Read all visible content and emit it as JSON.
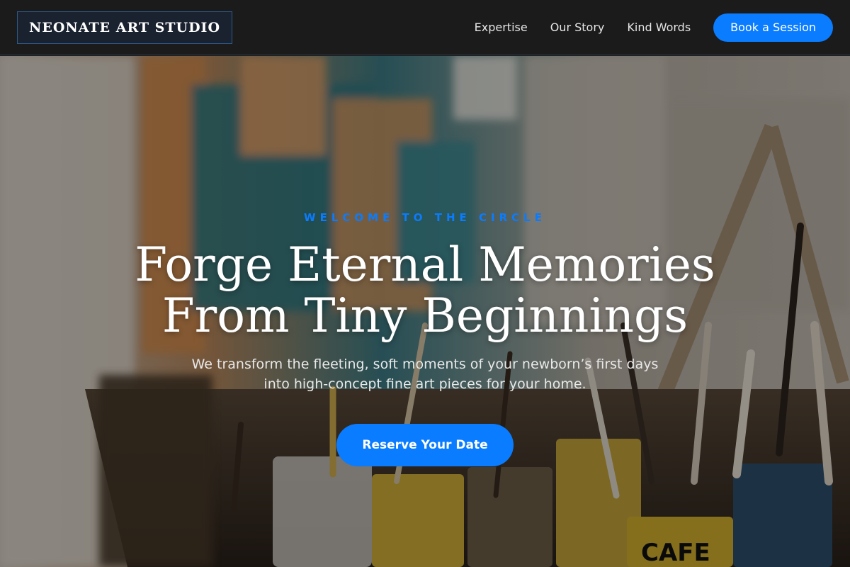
{
  "header": {
    "logo": "NEONATE ART STUDIO",
    "nav": [
      {
        "label": "Expertise"
      },
      {
        "label": "Our Story"
      },
      {
        "label": "Kind Words"
      }
    ],
    "cta_label": "Book a Session"
  },
  "hero": {
    "eyebrow": "WELCOME TO THE CIRCLE",
    "headline": "Forge Eternal Memories From Tiny Beginnings",
    "subtext": "We transform the fleeting, soft moments of your newborn’s first days into high-concept fine art pieces for your home.",
    "cta_label": "Reserve Your Date",
    "background_image": "art studio with paint brushes, paint cans and canvases",
    "background_label_text": "CAFE"
  },
  "colors": {
    "accent": "#0a7cff",
    "header_bg": "#1b1b1b",
    "text": "#ffffff"
  }
}
